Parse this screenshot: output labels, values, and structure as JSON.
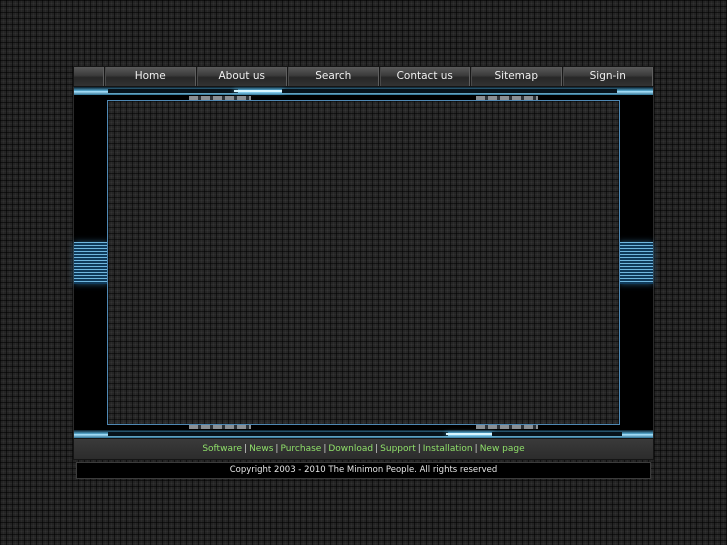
{
  "nav": {
    "items": [
      {
        "label": "Home"
      },
      {
        "label": "About us"
      },
      {
        "label": "Search"
      },
      {
        "label": "Contact us"
      },
      {
        "label": "Sitemap"
      },
      {
        "label": "Sign-in"
      }
    ]
  },
  "footer": {
    "links": [
      {
        "label": "Software"
      },
      {
        "label": "News"
      },
      {
        "label": "Purchase"
      },
      {
        "label": "Download"
      },
      {
        "label": "Support"
      },
      {
        "label": "Installation"
      },
      {
        "label": "New page"
      }
    ],
    "separator": "|",
    "copyright": "Copyright 2003 - 2010 The Minimon People. All rights reserved"
  },
  "colors": {
    "link": "#8fe06a",
    "accent": "#4f88b3",
    "glow": "#aee6ff"
  }
}
